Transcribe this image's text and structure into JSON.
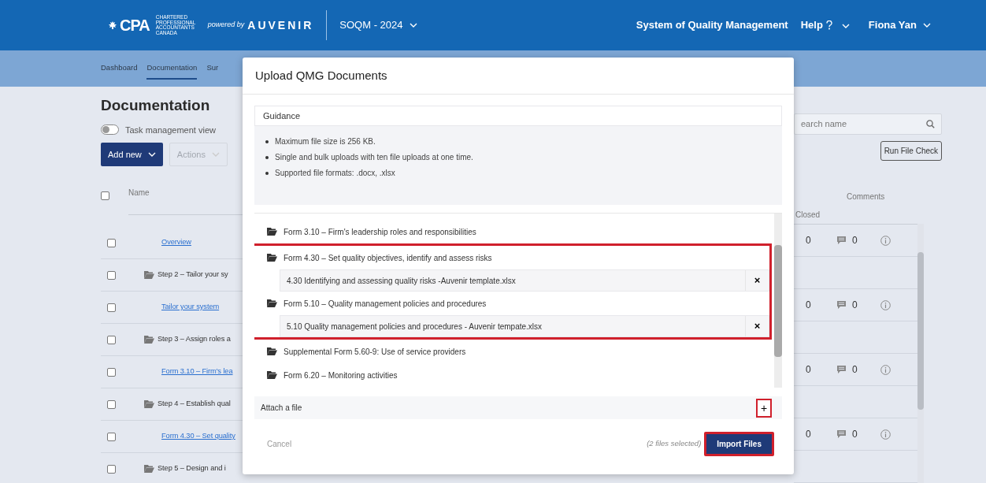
{
  "header": {
    "logo": "CPA",
    "logo_tagline": "CHARTERED PROFESSIONAL ACCOUNTANTS CANADA",
    "powered_by": "powered by",
    "brand": "AUVENIR",
    "engagement": "SOQM - 2024",
    "title": "System of Quality Management",
    "help": "Help",
    "user": "Fiona Yan"
  },
  "subnav": [
    {
      "label": "Dashboard",
      "selected": false
    },
    {
      "label": "Documentation",
      "selected": true
    },
    {
      "label": "Sur",
      "selected": false
    }
  ],
  "page": {
    "title": "Documentation",
    "toggle": {
      "label": "Task management view",
      "on": false
    },
    "add_button": "Add new",
    "actions_button": {
      "label": "Actions",
      "disabled": true
    },
    "search": {
      "placeholder": "earch name"
    },
    "run_check_button": "Run File Check"
  },
  "table": {
    "columns": [
      "Name",
      "Closed",
      "Comments"
    ],
    "select_all_checked": false,
    "rows": [
      {
        "kind": "link",
        "name": "Overview",
        "checked": false,
        "closed": "0",
        "comments": "0"
      },
      {
        "kind": "folder",
        "name": "Step 2 – Tailor your sy",
        "checked": false
      },
      {
        "kind": "link",
        "name": "Tailor your system",
        "checked": false,
        "closed": "0",
        "comments": "0"
      },
      {
        "kind": "folder",
        "name": "Step 3 – Assign roles a",
        "checked": false
      },
      {
        "kind": "link",
        "name": "Form 3.10 – Firm's lea",
        "checked": false,
        "closed": "0",
        "comments": "0"
      },
      {
        "kind": "folder",
        "name": "Step 4 – Establish qual",
        "checked": false
      },
      {
        "kind": "link",
        "name": "Form 4.30 – Set quality",
        "checked": false,
        "closed": "0",
        "comments": "0"
      },
      {
        "kind": "folder",
        "name": "Step 5 – Design and i",
        "checked": false
      }
    ]
  },
  "modal": {
    "title": "Upload QMG Documents",
    "guidance": {
      "title": "Guidance",
      "items": [
        "Maximum file size is 256 KB.",
        "Single and bulk uploads with ten file uploads at one time.",
        "Supported file formats: .docx, .xlsx"
      ]
    },
    "tree": [
      {
        "label": "Form 3.10 – Firm's leadership roles and responsibilities",
        "highlighted": false
      },
      {
        "label": "Form 4.30 – Set quality objectives, identify and assess risks",
        "highlighted": true,
        "files": [
          {
            "name": "4.30 Identifying and assessing quality risks -Auvenir template.xlsx",
            "remove": "×"
          }
        ]
      },
      {
        "label": "Form 5.10 – Quality management policies and procedures",
        "highlighted": true,
        "files": [
          {
            "name": "5.10 Quality management policies and procedures - Auvenir tempate.xlsx",
            "remove": "×"
          }
        ]
      },
      {
        "label": "Supplemental Form 5.60-9: Use of service providers",
        "highlighted": false
      },
      {
        "label": "Form 6.20 – Monitoring activities",
        "highlighted": false
      }
    ],
    "attach": {
      "label": "Attach a file",
      "button": "+",
      "highlighted": true
    },
    "footer": {
      "cancel": "Cancel",
      "selection_note": "(2 files selected)",
      "import_button": {
        "label": "Import Files",
        "highlighted": true
      }
    }
  }
}
